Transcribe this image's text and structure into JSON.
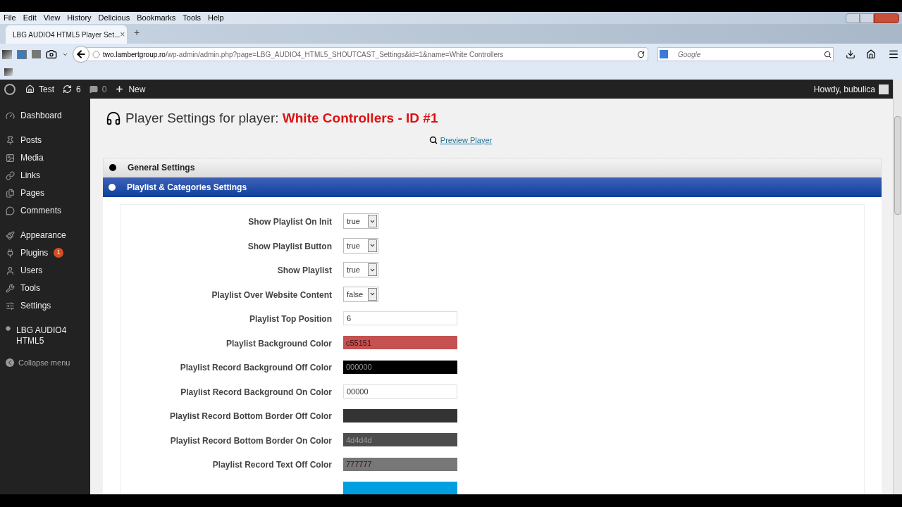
{
  "browser": {
    "menu": [
      "File",
      "Edit",
      "View",
      "History",
      "Delicious",
      "Bookmarks",
      "Tools",
      "Help"
    ],
    "tab": {
      "title": "LBG AUDIO4 HTML5 Player Set...",
      "close": "×",
      "new": "+"
    },
    "url": {
      "host": "two.lambertgroup.ro",
      "path": "/wp-admin/admin.php?page=LBG_AUDIO4_HTML5_SHOUTCAST_Settings&id=1&name=White Controllers"
    },
    "search": {
      "placeholder": "Google"
    }
  },
  "admin_bar": {
    "site": "Test",
    "updates": "6",
    "comments": "0",
    "new": "New",
    "greeting": "Howdy, bubulica"
  },
  "sidebar": {
    "groups": [
      [
        {
          "label": "Dashboard"
        }
      ],
      [
        {
          "label": "Posts"
        },
        {
          "label": "Media"
        },
        {
          "label": "Links"
        },
        {
          "label": "Pages"
        },
        {
          "label": "Comments"
        }
      ],
      [
        {
          "label": "Appearance"
        },
        {
          "label": "Plugins",
          "badge": "1"
        },
        {
          "label": "Users"
        },
        {
          "label": "Tools"
        },
        {
          "label": "Settings"
        }
      ],
      [
        {
          "label": "LBG AUDIO4 HTML5"
        }
      ]
    ],
    "collapse": "Collapse menu"
  },
  "page": {
    "title": "Player Settings for player: ",
    "player": "White Controllers - ID #1",
    "preview": "Preview Player"
  },
  "sections": [
    {
      "title": "General Settings",
      "expanded": false
    },
    {
      "title": "Playlist & Categories Settings",
      "expanded": true
    }
  ],
  "settings": [
    {
      "label": "Show Playlist On Init",
      "kind": "select",
      "value": "true"
    },
    {
      "label": "Show Playlist Button",
      "kind": "select",
      "value": "true"
    },
    {
      "label": "Show Playlist",
      "kind": "select",
      "value": "true"
    },
    {
      "label": "Playlist Over Website Content",
      "kind": "select",
      "value": "false"
    },
    {
      "label": "Playlist Top Position",
      "kind": "text",
      "value": "6"
    },
    {
      "label": "Playlist Background Color",
      "kind": "color",
      "value": "c55151",
      "color": "#c55151"
    },
    {
      "label": "Playlist Record Background Off Color",
      "kind": "color",
      "value": "000000",
      "color": "#000000"
    },
    {
      "label": "Playlist Record Background On Color",
      "kind": "text",
      "value": "00000"
    },
    {
      "label": "Playlist Record Bottom Border Off Color",
      "kind": "color",
      "color": "#333333"
    },
    {
      "label": "Playlist Record Bottom Border On Color",
      "kind": "color",
      "value": "4d4d4d",
      "color": "#4d4d4d"
    },
    {
      "label": "Playlist Record Text Off Color",
      "kind": "color",
      "value": "777777",
      "color": "#777777"
    },
    {
      "kind": "color",
      "color": "#00a0e0"
    }
  ]
}
